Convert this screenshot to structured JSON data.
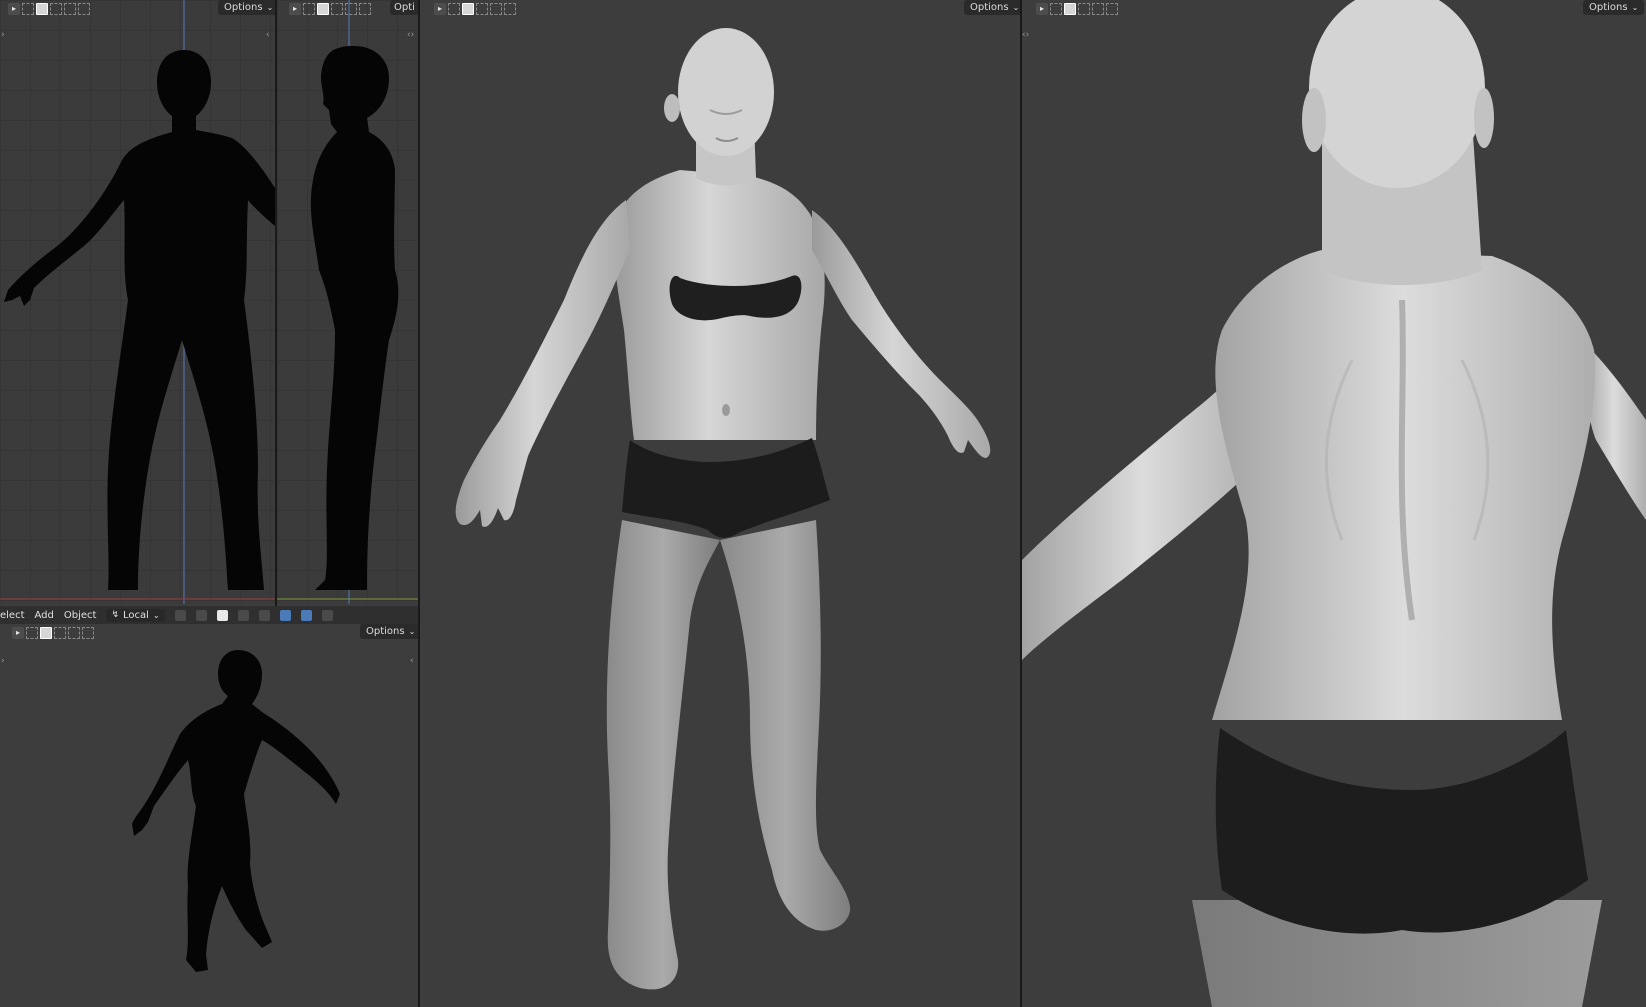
{
  "viewports": {
    "front": {
      "options_label": "Options"
    },
    "side": {
      "options_label": "Opti"
    },
    "perspective": {
      "options_label": "Options"
    },
    "back": {
      "options_label": "Options"
    },
    "bottom_left": {
      "options_label": "Options"
    }
  },
  "menubar": {
    "select_label": "elect",
    "add_label": "Add",
    "object_label": "Object",
    "orientation_label": "Local"
  },
  "colors": {
    "viewport_bg": "#3d3d3d",
    "silhouette": "#050505",
    "skin": "#c8c8c8",
    "garment": "#1e1e1e",
    "accent_blue": "#4b7ab8"
  }
}
